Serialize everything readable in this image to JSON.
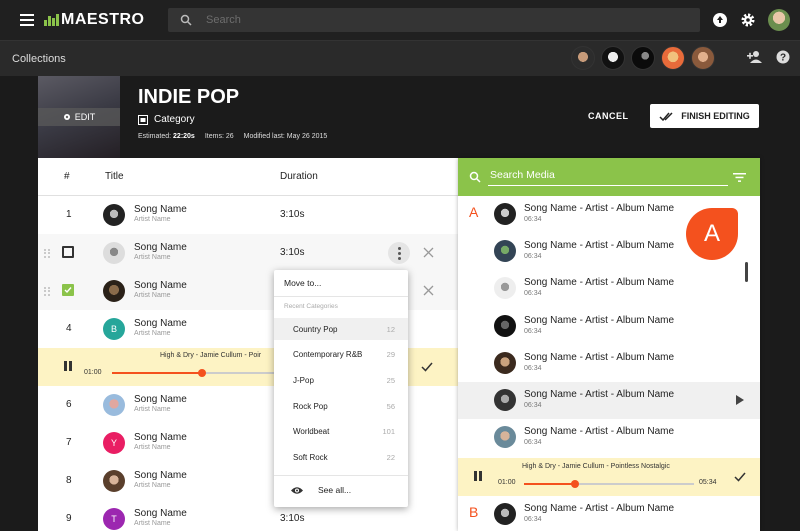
{
  "app": {
    "name": "MAESTRO",
    "search_placeholder": "Search"
  },
  "colors": {
    "accent": "#8bc34a",
    "orange": "#f4511e",
    "highlight": "#fdf3c4"
  },
  "collections_bar": {
    "title": "Collections"
  },
  "playlist": {
    "title": "INDIE POP",
    "edit_label": "EDIT",
    "category": "Category",
    "estimated_label": "Estimated:",
    "estimated_value": "22:20s",
    "items_label": "Items: 26",
    "modified_label": "Modified last: May 26 2015",
    "cancel_label": "CANCEL",
    "finish_label": "FINISH EDITING"
  },
  "table": {
    "headers": {
      "num": "#",
      "title": "Title",
      "duration": "Duration"
    },
    "rows": [
      {
        "num": "1",
        "song": "Song Name",
        "artist": "Artist Name",
        "duration": "3:10s"
      },
      {
        "num": "",
        "song": "Song Name",
        "artist": "Artist Name",
        "duration": "3:10s"
      },
      {
        "num": "",
        "song": "Song Name",
        "artist": "Artist Name",
        "duration": ""
      },
      {
        "num": "4",
        "song": "Song Name",
        "artist": "Artist Name",
        "duration": "",
        "letter": "B"
      },
      {
        "num": "6",
        "song": "Song Name",
        "artist": "Artist Name",
        "duration": ""
      },
      {
        "num": "7",
        "song": "Song Name",
        "artist": "Artist Name",
        "duration": "",
        "letter": "Y"
      },
      {
        "num": "8",
        "song": "Song Name",
        "artist": "Artist Name",
        "duration": ""
      },
      {
        "num": "9",
        "song": "Song Name",
        "artist": "Artist Name",
        "duration": "3:10s",
        "letter": "T"
      }
    ],
    "player": {
      "title": "High & Dry - Jamie Cullum - Poir",
      "current": "01:00",
      "progress": 0.45
    }
  },
  "context_menu": {
    "move_to": "Move to...",
    "recent_label": "Recent Categories",
    "items": [
      {
        "label": "Country Pop",
        "count": "12"
      },
      {
        "label": "Contemporary R&B",
        "count": "29"
      },
      {
        "label": "J-Pop",
        "count": "25"
      },
      {
        "label": "Rock Pop",
        "count": "56"
      },
      {
        "label": "Worldbeat",
        "count": "101"
      },
      {
        "label": "Soft Rock",
        "count": "22"
      }
    ],
    "see_all": "See all..."
  },
  "media": {
    "search_placeholder": "Search Media",
    "fab_letter": "A",
    "items": [
      {
        "letter": "A",
        "title": "Song Name - Artist - Album Name",
        "duration": "06:34"
      },
      {
        "letter": "",
        "title": "Song Name - Artist - Album Name",
        "duration": "06:34"
      },
      {
        "letter": "",
        "title": "Song Name - Artist - Album Name",
        "duration": "06:34"
      },
      {
        "letter": "",
        "title": "Song Name - Artist - Album Name",
        "duration": "06:34"
      },
      {
        "letter": "",
        "title": "Song Name - Artist - Album Name",
        "duration": "06:34"
      },
      {
        "letter": "",
        "title": "Song Name - Artist - Album Name",
        "duration": "06:34"
      },
      {
        "letter": "",
        "title": "Song Name - Artist - Album Name",
        "duration": "06:34"
      },
      {
        "letter": "B",
        "title": "Song Name - Artist - Album Name",
        "duration": "06:34"
      }
    ],
    "player": {
      "title": "High & Dry - Jamie Cullum - Pointless Nostalgic",
      "current": "01:00",
      "end": "05:34",
      "progress": 0.3
    }
  }
}
